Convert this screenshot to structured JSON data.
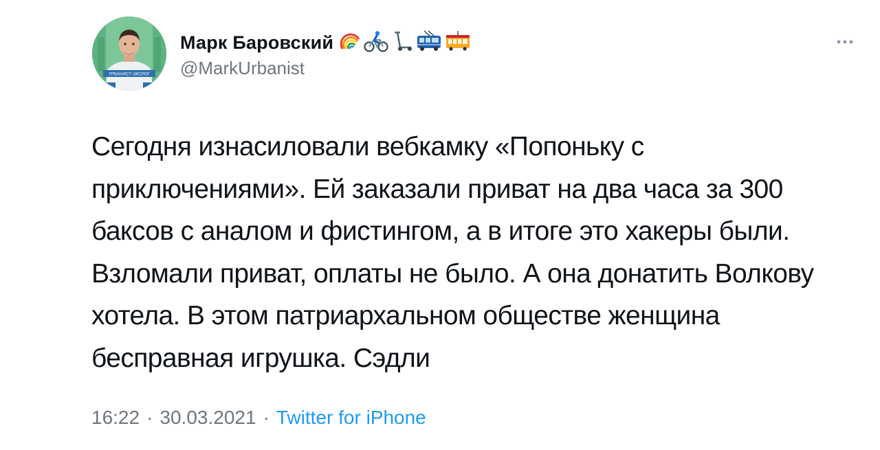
{
  "tweet": {
    "author": {
      "display_name": "Марк Баровский",
      "handle": "@MarkUrbanist",
      "avatar_badge_text": "УРБАНИСТ-ЭКОЛОГ",
      "name_emojis": [
        "rainbow-icon",
        "cyclist-icon",
        "kick-scooter-icon",
        "trolleybus-icon",
        "tram-car-icon"
      ]
    },
    "text": "Сегодня изнасиловали вебкамку «Попоньку с\nприключениями». Ей заказали приват на два часа за 300\nбаксов с аналом и фистингом, а в итоге это хакеры были.\nВзломали приват, оплаты не было. А она донатить Волкову\nхотела. В этом патриархальном обществе женщина\nбесправная игрушка. Сэдли",
    "time": "16:22",
    "date": "30.03.2021",
    "separator": "·",
    "source": "Twitter for iPhone",
    "more_icon": "more-horizontal-icon"
  },
  "colors": {
    "text_primary": "#0f1419",
    "text_secondary": "#6e767d",
    "link": "#1d9bf0",
    "background": "#ffffff"
  }
}
